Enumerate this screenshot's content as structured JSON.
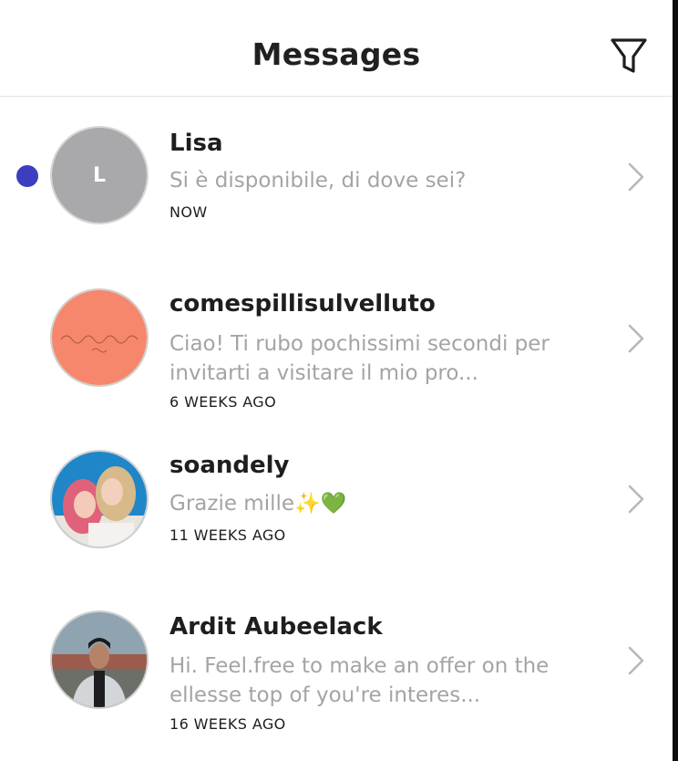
{
  "header": {
    "title": "Messages",
    "filter_icon": "filter-icon"
  },
  "colors": {
    "unread": "#3b3fbf",
    "muted_text": "#a4a4a8",
    "text": "#1e1e1e"
  },
  "conversations": [
    {
      "name": "Lisa",
      "avatar_letter": "L",
      "preview": "Si è disponibile, di dove sei?",
      "time": "NOW",
      "unread": true
    },
    {
      "name": "comespillisulvelluto",
      "preview": "Ciao! Ti rubo pochissimi secondi per invitarti a visitare il mio pro...",
      "time": "6 WEEKS AGO",
      "unread": false
    },
    {
      "name": "soandely",
      "preview": "Grazie mille✨💚",
      "time": "11 WEEKS AGO",
      "unread": false
    },
    {
      "name": "Ardit Aubeelack",
      "preview": "Hi. Feel.free to make an offer on the ellesse top of you're interes...",
      "time": "16 WEEKS AGO",
      "unread": false
    }
  ]
}
